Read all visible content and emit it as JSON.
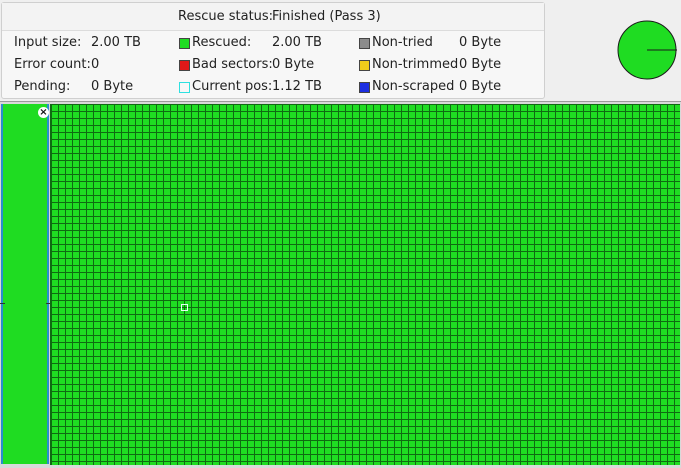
{
  "status": {
    "rescue_label": "Rescue status:",
    "rescue_value": "Finished (Pass 3)",
    "input_size_label": "Input size:",
    "input_size_value": "2.00 TB",
    "error_count_label": "Error count:",
    "error_count_value": "0",
    "pending_label": "Pending:",
    "pending_value": "0 Byte",
    "rescued_label": "Rescued:",
    "rescued_value": "2.00 TB",
    "bad_sectors_label": "Bad sectors:",
    "bad_sectors_value": "0 Byte",
    "current_pos_label": "Current pos:",
    "current_pos_value": "1.12 TB",
    "non_tried_label": "Non-tried",
    "non_tried_value": "0 Byte",
    "non_trimmed_label": "Non-trimmed",
    "non_trimmed_value": "0 Byte",
    "non_scraped_label": "Non-scraped",
    "non_scraped_value": "0 Byte"
  },
  "colors": {
    "rescued": "#1fdc22",
    "bad_sectors": "#e01818",
    "current_pos": "#2ee0e0",
    "non_tried": "#8c8c8c",
    "non_trimmed": "#f0cc1a",
    "non_scraped": "#1c2ee0",
    "grid_line": "#0f6a12",
    "overview_border": "#2b8ccf"
  },
  "pie": {
    "rescued_fraction": 1.0
  },
  "icons": {
    "close": "close-icon"
  }
}
